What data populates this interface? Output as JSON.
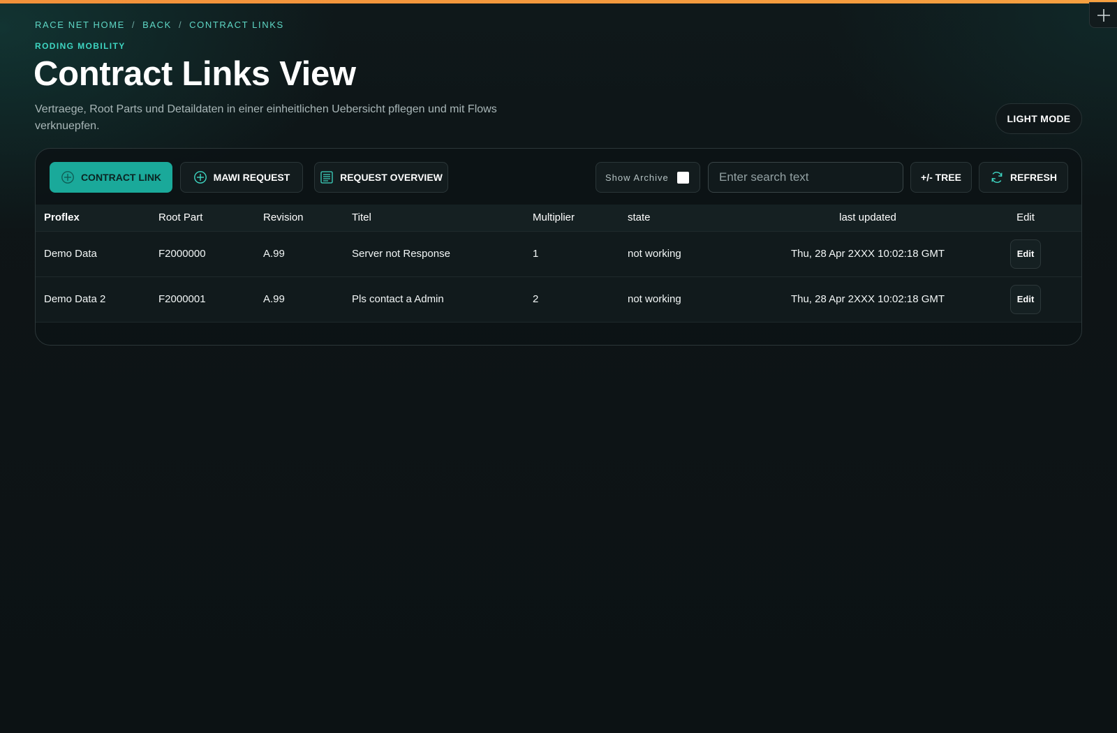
{
  "breadcrumb": {
    "home": "Race Net Home",
    "back": "Back",
    "current": "Contract Links",
    "separator": "/"
  },
  "header": {
    "eyebrow": "RODING MOBILITY",
    "title": "Contract Links View",
    "subtitle": "Vertraege, Root Parts und Detaildaten in einer einheitlichen Uebersicht pflegen und mit Flows verknuepfen."
  },
  "mode_toggle": {
    "label": "LIGHT MODE"
  },
  "toolbar": {
    "contract_link": {
      "label": "Contract Link",
      "icon": "plus-circle-icon"
    },
    "mawi_request": {
      "label": "Mawi Request",
      "icon": "plus-circle-icon"
    },
    "request_overview": {
      "label": "Request Overview",
      "icon": "list-document-icon"
    },
    "show_archive": {
      "label": "Show Archive",
      "checked": false
    },
    "search": {
      "placeholder": "Enter search text",
      "value": ""
    },
    "tree": {
      "label": "+/- Tree"
    },
    "refresh": {
      "label": "Refresh",
      "icon": "refresh-icon"
    }
  },
  "table": {
    "columns": {
      "proflex": "Proflex",
      "root_part": "Root Part",
      "revision": "Revision",
      "titel": "Titel",
      "multiplier": "Multiplier",
      "state": "state",
      "last_updated": "last updated",
      "edit": "Edit"
    },
    "rows": [
      {
        "proflex": "Demo Data",
        "root_part": "F2000000",
        "revision": "A.99",
        "titel": "Server not Response",
        "multiplier": "1",
        "state": "not working",
        "last_updated": "Thu, 28 Apr 2XXX 10:02:18 GMT",
        "edit": "Edit"
      },
      {
        "proflex": "Demo Data 2",
        "root_part": "F2000001",
        "revision": "A.99",
        "titel": "Pls contact a Admin",
        "multiplier": "2",
        "state": "not working",
        "last_updated": "Thu, 28 Apr 2XXX 10:02:18 GMT",
        "edit": "Edit"
      }
    ]
  },
  "colors": {
    "accent": "#1aa99a",
    "accent_text": "#3ed6c2",
    "top_bar": "#f2913a",
    "background": "#0e1517"
  }
}
